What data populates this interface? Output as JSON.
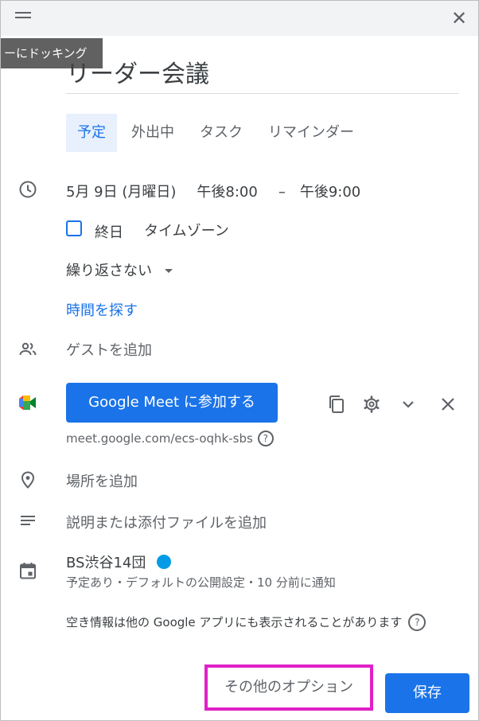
{
  "tooltip": {
    "text": "ーにドッキング"
  },
  "event": {
    "title": "リーダー会議"
  },
  "tabs": [
    {
      "label": "予定",
      "active": true
    },
    {
      "label": "外出中"
    },
    {
      "label": "タスク"
    },
    {
      "label": "リマインダー"
    }
  ],
  "datetime": {
    "date": "5月 9日 (月曜日)",
    "start": "午後8:00",
    "dash": "–",
    "end": "午後9:00"
  },
  "allday": {
    "label": "終日",
    "timezone": "タイムゾーン"
  },
  "repeat": {
    "label": "繰り返さない"
  },
  "find_time": {
    "label": "時間を探す"
  },
  "guests": {
    "placeholder": "ゲストを追加"
  },
  "meet": {
    "button": "Google Meet に参加する",
    "link": "meet.google.com/ecs-oqhk-sbs",
    "help": "?"
  },
  "location": {
    "placeholder": "場所を追加"
  },
  "description": {
    "placeholder": "説明または添付ファイルを追加"
  },
  "calendar": {
    "name": "BS渋谷14団",
    "color": "#039be5",
    "details": "予定あり・デフォルトの公開設定・10 分前に通知"
  },
  "availability": {
    "note": "空き情報は他の Google アプリにも表示されることがあります",
    "help": "?"
  },
  "footer": {
    "more_options": "その他のオプション",
    "save": "保存"
  },
  "colors": {
    "accent": "#1a73e8",
    "highlight": "#e020c8"
  }
}
